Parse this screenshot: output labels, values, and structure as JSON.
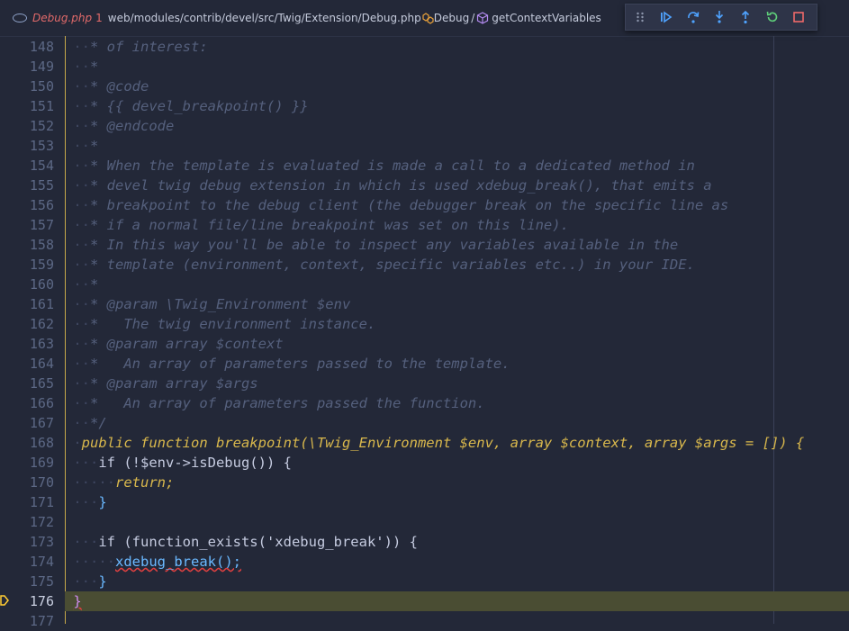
{
  "breadcrumb": {
    "file_name": "Debug.php",
    "problem_count": "1",
    "path": "web/modules/contrib/devel/src/Twig/Extension/Debug.php",
    "class": "Debug",
    "method": "getContextVariables"
  },
  "toolbar": {
    "actions": [
      "drag-handle",
      "continue",
      "step-over",
      "step-into",
      "step-out",
      "restart",
      "stop"
    ]
  },
  "colors": {
    "accent": "#d9b84c",
    "background": "#232838",
    "highlight": "#4a4d33"
  },
  "lines": [
    {
      "num": "148",
      "text": "* of interest:"
    },
    {
      "num": "149",
      "text": "*"
    },
    {
      "num": "150",
      "text": "* @code"
    },
    {
      "num": "151",
      "text": "* {{ devel_breakpoint() }}"
    },
    {
      "num": "152",
      "text": "* @endcode"
    },
    {
      "num": "153",
      "text": "*"
    },
    {
      "num": "154",
      "text": "* When the template is evaluated is made a call to a dedicated method in"
    },
    {
      "num": "155",
      "text": "* devel twig debug extension in which is used xdebug_break(), that emits a"
    },
    {
      "num": "156",
      "text": "* breakpoint to the debug client (the debugger break on the specific line as"
    },
    {
      "num": "157",
      "text": "* if a normal file/line breakpoint was set on this line)."
    },
    {
      "num": "158",
      "text": "* In this way you'll be able to inspect any variables available in the"
    },
    {
      "num": "159",
      "text": "* template (environment, context, specific variables etc..) in your IDE."
    },
    {
      "num": "160",
      "text": "*"
    },
    {
      "num": "161",
      "text": "* @param \\Twig_Environment $env"
    },
    {
      "num": "162",
      "text": "*   The twig environment instance."
    },
    {
      "num": "163",
      "text": "* @param array $context"
    },
    {
      "num": "164",
      "text": "*   An array of parameters passed to the template."
    },
    {
      "num": "165",
      "text": "* @param array $args"
    },
    {
      "num": "166",
      "text": "*   An array of parameters passed the function."
    },
    {
      "num": "167",
      "text": "*/"
    },
    {
      "num": "168",
      "text": "public function breakpoint(\\Twig_Environment $env, array $context, array $args = []) {"
    },
    {
      "num": "169",
      "text": "if (!$env->isDebug()) {"
    },
    {
      "num": "170",
      "text": "return;"
    },
    {
      "num": "171",
      "text": "}"
    },
    {
      "num": "172",
      "text": ""
    },
    {
      "num": "173",
      "text": "if (function_exists('xdebug_break')) {"
    },
    {
      "num": "174",
      "text": "xdebug_break();"
    },
    {
      "num": "175",
      "text": "}"
    },
    {
      "num": "176",
      "text": "}"
    },
    {
      "num": "177",
      "text": ""
    }
  ],
  "current_line": "176"
}
